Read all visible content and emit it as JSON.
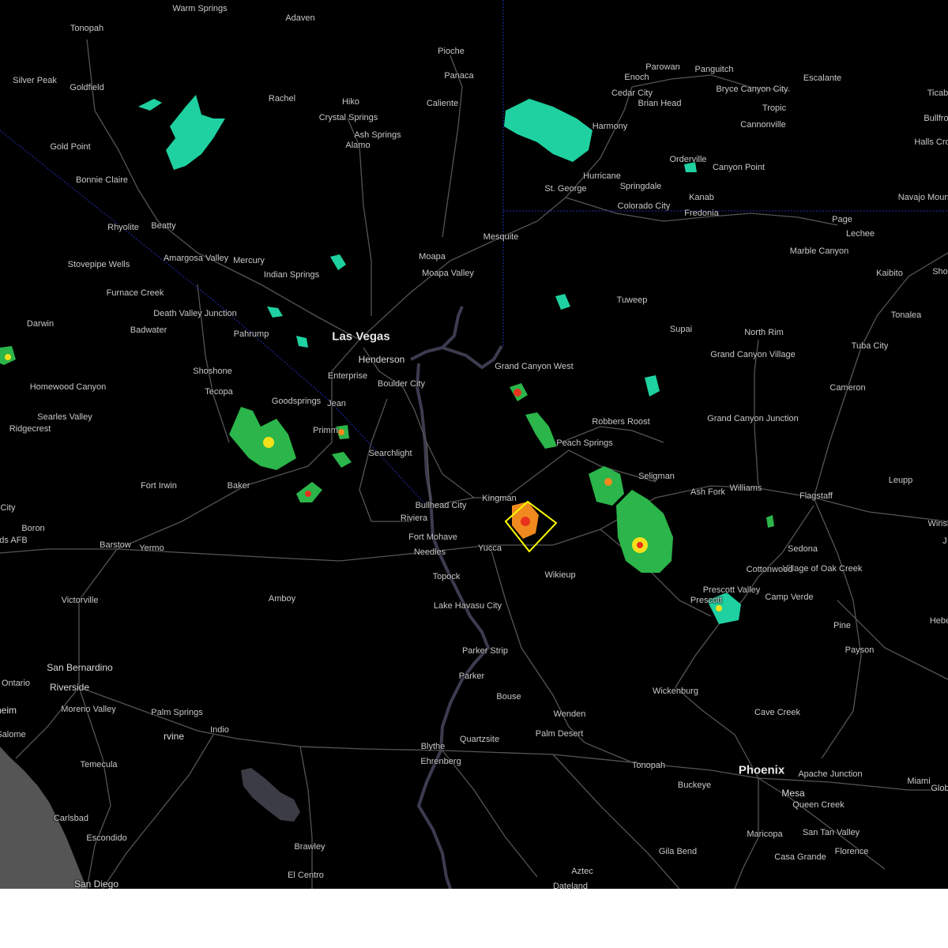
{
  "colors": {
    "background": "#000000",
    "roads": "#5a5a5a",
    "water": "#3c3c46",
    "ocean": "#555555",
    "state_border": "#1f2fb8",
    "warning_polygon": "#ffff00",
    "radar_light": "#1fd1a0",
    "radar_green": "#2bb54a",
    "radar_yellow": "#f2e01b",
    "radar_orange": "#f08a1e",
    "radar_red": "#e8321e"
  },
  "cities": [
    {
      "name": "Warm Springs",
      "size": "small"
    },
    {
      "name": "Adaven",
      "size": "small"
    },
    {
      "name": "Tonopah",
      "size": "small"
    },
    {
      "name": "Pioche",
      "size": "small"
    },
    {
      "name": "Panaca",
      "size": "small"
    },
    {
      "name": "Parowan",
      "size": "small"
    },
    {
      "name": "Panguitch",
      "size": "small"
    },
    {
      "name": "Enoch",
      "size": "small"
    },
    {
      "name": "Bryce Canyon City",
      "size": "small"
    },
    {
      "name": "Escalante",
      "size": "small"
    },
    {
      "name": "Ticab",
      "size": "small"
    },
    {
      "name": "Silver Peak",
      "size": "small"
    },
    {
      "name": "Goldfield",
      "size": "small"
    },
    {
      "name": "Rachel",
      "size": "small"
    },
    {
      "name": "Hiko",
      "size": "small"
    },
    {
      "name": "Caliente",
      "size": "small"
    },
    {
      "name": "Cedar City",
      "size": "small"
    },
    {
      "name": "Brian Head",
      "size": "small"
    },
    {
      "name": "Tropic",
      "size": "small"
    },
    {
      "name": "Bullfro",
      "size": "small"
    },
    {
      "name": "Crystal Springs",
      "size": "small"
    },
    {
      "name": "Ash Springs",
      "size": "small"
    },
    {
      "name": "Alamo",
      "size": "small"
    },
    {
      "name": "Cannonville",
      "size": "small"
    },
    {
      "name": "Halls Cro",
      "size": "small"
    },
    {
      "name": "Harmony",
      "size": "small"
    },
    {
      "name": "Gold Point",
      "size": "small"
    },
    {
      "name": "Orderville",
      "size": "small"
    },
    {
      "name": "Bonnie Claire",
      "size": "small"
    },
    {
      "name": "Hurricane",
      "size": "small"
    },
    {
      "name": "Canyon Point",
      "size": "small"
    },
    {
      "name": "St. George",
      "size": "small"
    },
    {
      "name": "Springdale",
      "size": "small"
    },
    {
      "name": "Kanab",
      "size": "small"
    },
    {
      "name": "Navajo Mountain",
      "size": "small"
    },
    {
      "name": "Colorado City",
      "size": "small"
    },
    {
      "name": "Fredonia",
      "size": "small"
    },
    {
      "name": "Page",
      "size": "small"
    },
    {
      "name": "Rhyolite",
      "size": "small"
    },
    {
      "name": "Beatty",
      "size": "small"
    },
    {
      "name": "Lechee",
      "size": "small"
    },
    {
      "name": "Mesquite",
      "size": "small"
    },
    {
      "name": "Marble Canyon",
      "size": "small"
    },
    {
      "name": "Amargosa Valley",
      "size": "small"
    },
    {
      "name": "Mercury",
      "size": "small"
    },
    {
      "name": "Moapa",
      "size": "small"
    },
    {
      "name": "Stovepipe Wells",
      "size": "small"
    },
    {
      "name": "Kaibito",
      "size": "small"
    },
    {
      "name": "Sho",
      "size": "small"
    },
    {
      "name": "Indian Springs",
      "size": "small"
    },
    {
      "name": "Moapa Valley",
      "size": "small"
    },
    {
      "name": "Furnace Creek",
      "size": "small"
    },
    {
      "name": "Tuweep",
      "size": "small"
    },
    {
      "name": "Death Valley Junction",
      "size": "small"
    },
    {
      "name": "Tonalea",
      "size": "small"
    },
    {
      "name": "Darwin",
      "size": "small"
    },
    {
      "name": "Badwater",
      "size": "small"
    },
    {
      "name": "Supai",
      "size": "small"
    },
    {
      "name": "North Rim",
      "size": "small"
    },
    {
      "name": "Pahrump",
      "size": "small"
    },
    {
      "name": "Las Vegas",
      "size": "major"
    },
    {
      "name": "Grand Canyon Village",
      "size": "small"
    },
    {
      "name": "Tuba City",
      "size": "small"
    },
    {
      "name": "Henderson",
      "size": "mid"
    },
    {
      "name": "Grand Canyon West",
      "size": "small"
    },
    {
      "name": "Shoshone",
      "size": "small"
    },
    {
      "name": "Enterprise",
      "size": "small"
    },
    {
      "name": "Boulder City",
      "size": "small"
    },
    {
      "name": "Homewood Canyon",
      "size": "small"
    },
    {
      "name": "Cameron",
      "size": "small"
    },
    {
      "name": "Tecopa",
      "size": "small"
    },
    {
      "name": "Goodsprings",
      "size": "small"
    },
    {
      "name": "Jean",
      "size": "small"
    },
    {
      "name": "Searles Valley",
      "size": "small"
    },
    {
      "name": "Grand Canyon Junction",
      "size": "small"
    },
    {
      "name": "Robbers Roost",
      "size": "small"
    },
    {
      "name": "Ridgecrest",
      "size": "small"
    },
    {
      "name": "Primm",
      "size": "small"
    },
    {
      "name": "Peach Springs",
      "size": "small"
    },
    {
      "name": "Searchlight",
      "size": "small"
    },
    {
      "name": "Seligman",
      "size": "small"
    },
    {
      "name": "Leupp",
      "size": "small"
    },
    {
      "name": "Fort Irwin",
      "size": "small"
    },
    {
      "name": "Baker",
      "size": "small"
    },
    {
      "name": "Ash Fork",
      "size": "small"
    },
    {
      "name": "Williams",
      "size": "small"
    },
    {
      "name": "Flagstaff",
      "size": "small"
    },
    {
      "name": "Kingman",
      "size": "small"
    },
    {
      "name": "City",
      "size": "small"
    },
    {
      "name": "Bullhead City",
      "size": "small"
    },
    {
      "name": "Winsl",
      "size": "small"
    },
    {
      "name": "Boron",
      "size": "small"
    },
    {
      "name": "Riviera",
      "size": "small"
    },
    {
      "name": "J",
      "size": "small"
    },
    {
      "name": "ds AFB",
      "size": "small"
    },
    {
      "name": "Fort Mohave",
      "size": "small"
    },
    {
      "name": "Barstow",
      "size": "small"
    },
    {
      "name": "Yermo",
      "size": "small"
    },
    {
      "name": "Yucca",
      "size": "small"
    },
    {
      "name": "Sedona",
      "size": "small"
    },
    {
      "name": "Needles",
      "size": "small"
    },
    {
      "name": "Village of Oak Creek",
      "size": "small"
    },
    {
      "name": "Cottonwood",
      "size": "small"
    },
    {
      "name": "Wikieup",
      "size": "small"
    },
    {
      "name": "Topock",
      "size": "small"
    },
    {
      "name": "Prescott Valley",
      "size": "small"
    },
    {
      "name": "Amboy",
      "size": "small"
    },
    {
      "name": "Camp Verde",
      "size": "small"
    },
    {
      "name": "Victorville",
      "size": "small"
    },
    {
      "name": "Prescott",
      "size": "small"
    },
    {
      "name": "Lake Havasu City",
      "size": "small"
    },
    {
      "name": "Hebe",
      "size": "small"
    },
    {
      "name": "Pine",
      "size": "small"
    },
    {
      "name": "Parker Strip",
      "size": "small"
    },
    {
      "name": "Payson",
      "size": "small"
    },
    {
      "name": "San Bernardino",
      "size": "mid"
    },
    {
      "name": "Parker",
      "size": "small"
    },
    {
      "name": "Ontario",
      "size": "small"
    },
    {
      "name": "Riverside",
      "size": "mid"
    },
    {
      "name": "Wickenburg",
      "size": "small"
    },
    {
      "name": "Bouse",
      "size": "small"
    },
    {
      "name": "Moreno Valley",
      "size": "small"
    },
    {
      "name": "heim",
      "size": "mid"
    },
    {
      "name": "Palm Springs",
      "size": "small"
    },
    {
      "name": "Wenden",
      "size": "small"
    },
    {
      "name": "Cave Creek",
      "size": "small"
    },
    {
      "name": "Indio",
      "size": "small"
    },
    {
      "name": "rvine",
      "size": "mid"
    },
    {
      "name": "Palm Desert",
      "size": "small"
    },
    {
      "name": "Salome",
      "size": "small"
    },
    {
      "name": "Quartzsite",
      "size": "small"
    },
    {
      "name": "Blythe",
      "size": "small"
    },
    {
      "name": "Temecula",
      "size": "small"
    },
    {
      "name": "Ehrenberg",
      "size": "small"
    },
    {
      "name": "Tonopah",
      "size": "small"
    },
    {
      "name": "Phoenix",
      "size": "major"
    },
    {
      "name": "Apache Junction",
      "size": "small"
    },
    {
      "name": "Buckeye",
      "size": "small"
    },
    {
      "name": "Miami",
      "size": "small"
    },
    {
      "name": "Glob",
      "size": "small"
    },
    {
      "name": "Mesa",
      "size": "mid"
    },
    {
      "name": "Queen Creek",
      "size": "small"
    },
    {
      "name": "Carlsbad",
      "size": "small"
    },
    {
      "name": "San Tan Valley",
      "size": "small"
    },
    {
      "name": "Escondido",
      "size": "small"
    },
    {
      "name": "Maricopa",
      "size": "small"
    },
    {
      "name": "Florence",
      "size": "small"
    },
    {
      "name": "Brawley",
      "size": "small"
    },
    {
      "name": "Casa Grande",
      "size": "small"
    },
    {
      "name": "Gila Bend",
      "size": "small"
    },
    {
      "name": "El Centro",
      "size": "small"
    },
    {
      "name": "Aztec",
      "size": "small"
    },
    {
      "name": "San Diego",
      "size": "mid"
    },
    {
      "name": "Dateland",
      "size": "small"
    }
  ]
}
